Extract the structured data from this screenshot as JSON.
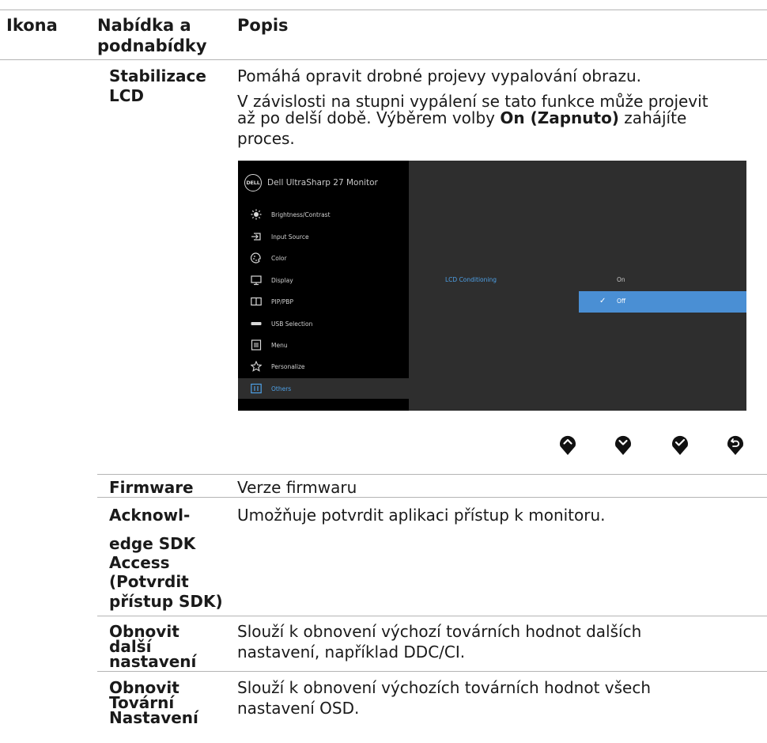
{
  "header": {
    "col_icon": "Ikona",
    "col_menu_line1": "Nabídka a",
    "col_menu_line2": "podnabídky",
    "col_desc": "Popis"
  },
  "lcd": {
    "name_line1": "Stabilizace",
    "name_line2": "LCD",
    "desc_line1": "Pomáhá opravit drobné projevy vypalování obrazu.",
    "desc_line2": "V závislosti na stupni vypálení se tato funkce může projevit",
    "desc_line3_a": "až po delší době. Výběrem volby ",
    "desc_line3_bold": "On (Zapnuto)",
    "desc_line3_b": " zahájíte",
    "desc_line4": "proces."
  },
  "osd": {
    "logo": "DELL",
    "title": "Dell UltraSharp 27 Monitor",
    "menu": [
      {
        "label": "Brightness/Contrast",
        "icon": "brightness-icon"
      },
      {
        "label": "Input Source",
        "icon": "input-source-icon"
      },
      {
        "label": "Color",
        "icon": "color-palette-icon"
      },
      {
        "label": "Display",
        "icon": "display-icon"
      },
      {
        "label": "PIP/PBP",
        "icon": "pip-pbp-icon"
      },
      {
        "label": "USB Selection",
        "icon": "usb-icon"
      },
      {
        "label": "Menu",
        "icon": "menu-icon"
      },
      {
        "label": "Personalize",
        "icon": "star-icon"
      },
      {
        "label": "Others",
        "icon": "others-icon",
        "selected": true
      }
    ],
    "setting_label": "LCD Conditioning",
    "option_on": "On",
    "option_off": "Off",
    "accent_color": "#4a8fd4"
  },
  "buttons": [
    "up-button",
    "down-button",
    "ok-button",
    "back-button"
  ],
  "rows": {
    "firmware_name": "Firmware",
    "firmware_desc": "Verze firmwaru",
    "sdk_name_1": "Acknowl-",
    "sdk_name_2": "edge SDK",
    "sdk_name_3": "Access",
    "sdk_name_4": "(Potvrdit",
    "sdk_name_5": "přístup SDK)",
    "sdk_desc": "Umožňuje potvrdit aplikaci přístup k monitoru.",
    "other_name_1": "Obnovit",
    "other_name_2": "další",
    "other_name_3": "nastavení",
    "other_desc_1": "Slouží k obnovení výchozí továrních hodnot dalších",
    "other_desc_2": "nastavení, například DDC/CI.",
    "factory_name_1": "Obnovit",
    "factory_name_2": "Tovární",
    "factory_name_3": "Nastavení",
    "factory_desc_1": "Slouží k obnovení výchozích továrních hodnot všech",
    "factory_desc_2": "nastavení OSD."
  }
}
